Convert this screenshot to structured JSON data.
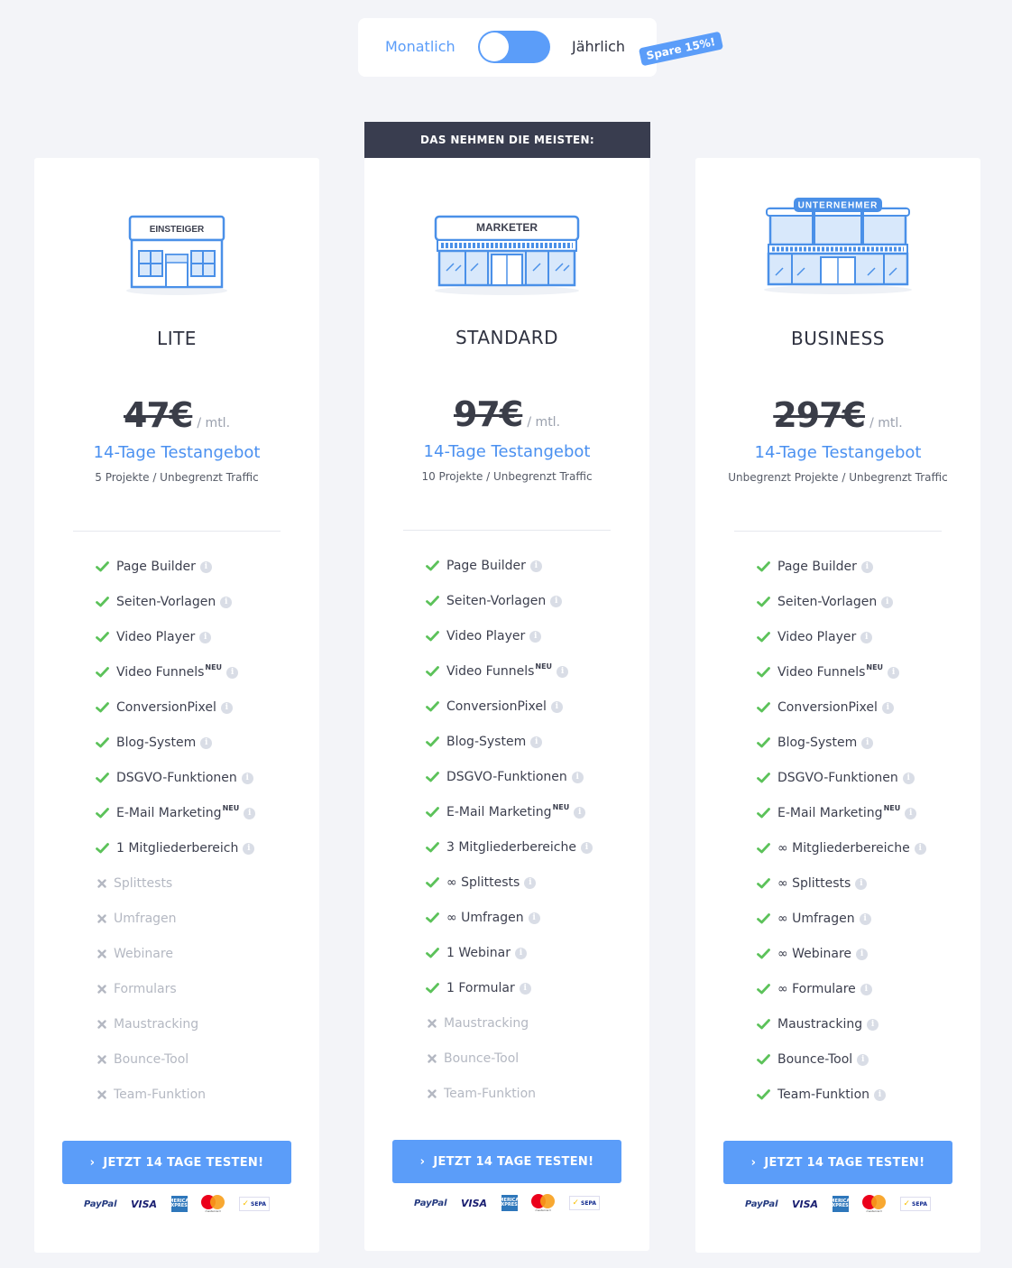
{
  "billing_toggle": {
    "monthly_label": "Monatlich",
    "yearly_label": "Jährlich",
    "save_badge": "Spare 15%!"
  },
  "popular_banner": "DAS NEHMEN DIE MEISTEN:",
  "colors": {
    "accent": "#5b9df9",
    "check": "#5cc25a",
    "banner": "#393d4f",
    "background": "#f3f4f8"
  },
  "plans": [
    {
      "shop_sign": "EINSTEIGER",
      "name": "LITE",
      "old_price": "47€",
      "price_unit": "/ mtl.",
      "trial": "14-Tage Testangebot",
      "limits": "5 Projekte / Unbegrenzt Traffic",
      "cta": "JETZT 14 TAGE TESTEN!",
      "payments": {
        "paypal": "PayPal",
        "visa": "VISA",
        "amex": "AMERICAN EXPRESS",
        "mastercard": "mastercard",
        "sepa": "SEPA"
      },
      "features": [
        {
          "text": "Page Builder",
          "included": true,
          "neu": false
        },
        {
          "text": "Seiten-Vorlagen",
          "included": true,
          "neu": false
        },
        {
          "text": "Video Player",
          "included": true,
          "neu": false
        },
        {
          "text": "Video Funnels",
          "included": true,
          "neu": true
        },
        {
          "text": "ConversionPixel",
          "included": true,
          "neu": false
        },
        {
          "text": "Blog-System",
          "included": true,
          "neu": false
        },
        {
          "text": "DSGVO-Funktionen",
          "included": true,
          "neu": false
        },
        {
          "text": "E-Mail Marketing",
          "included": true,
          "neu": true
        },
        {
          "text": "1 Mitgliederbereich",
          "included": true,
          "neu": false
        },
        {
          "text": "Splittests",
          "included": false,
          "neu": false
        },
        {
          "text": "Umfragen",
          "included": false,
          "neu": false
        },
        {
          "text": "Webinare",
          "included": false,
          "neu": false
        },
        {
          "text": "Formulars",
          "included": false,
          "neu": false
        },
        {
          "text": "Maustracking",
          "included": false,
          "neu": false
        },
        {
          "text": "Bounce-Tool",
          "included": false,
          "neu": false
        },
        {
          "text": "Team-Funktion",
          "included": false,
          "neu": false
        }
      ]
    },
    {
      "shop_sign": "MARKETER",
      "name": "STANDARD",
      "old_price": "97€",
      "price_unit": "/ mtl.",
      "trial": "14-Tage Testangebot",
      "limits": "10 Projekte / Unbegrenzt Traffic",
      "cta": "JETZT 14 TAGE TESTEN!",
      "payments": {
        "paypal": "PayPal",
        "visa": "VISA",
        "amex": "AMERICAN EXPRESS",
        "mastercard": "mastercard",
        "sepa": "SEPA"
      },
      "features": [
        {
          "text": "Page Builder",
          "included": true,
          "neu": false
        },
        {
          "text": "Seiten-Vorlagen",
          "included": true,
          "neu": false
        },
        {
          "text": "Video Player",
          "included": true,
          "neu": false
        },
        {
          "text": "Video Funnels",
          "included": true,
          "neu": true
        },
        {
          "text": "ConversionPixel",
          "included": true,
          "neu": false
        },
        {
          "text": "Blog-System",
          "included": true,
          "neu": false
        },
        {
          "text": "DSGVO-Funktionen",
          "included": true,
          "neu": false
        },
        {
          "text": "E-Mail Marketing",
          "included": true,
          "neu": true
        },
        {
          "text": "3 Mitgliederbereiche",
          "included": true,
          "neu": false
        },
        {
          "text": "∞ Splittests",
          "included": true,
          "neu": false
        },
        {
          "text": "∞ Umfragen",
          "included": true,
          "neu": false
        },
        {
          "text": "1 Webinar",
          "included": true,
          "neu": false
        },
        {
          "text": "1 Formular",
          "included": true,
          "neu": false
        },
        {
          "text": "Maustracking",
          "included": false,
          "neu": false
        },
        {
          "text": "Bounce-Tool",
          "included": false,
          "neu": false
        },
        {
          "text": "Team-Funktion",
          "included": false,
          "neu": false
        }
      ]
    },
    {
      "shop_sign": "UNTERNEHMER",
      "name": "BUSINESS",
      "old_price": "297€",
      "price_unit": "/ mtl.",
      "trial": "14-Tage Testangebot",
      "limits": "Unbegrenzt Projekte / Unbegrenzt Traffic",
      "cta": "JETZT 14 TAGE TESTEN!",
      "payments": {
        "paypal": "PayPal",
        "visa": "VISA",
        "amex": "AMERICAN EXPRESS",
        "mastercard": "mastercard",
        "sepa": "SEPA"
      },
      "features": [
        {
          "text": "Page Builder",
          "included": true,
          "neu": false
        },
        {
          "text": "Seiten-Vorlagen",
          "included": true,
          "neu": false
        },
        {
          "text": "Video Player",
          "included": true,
          "neu": false
        },
        {
          "text": "Video Funnels",
          "included": true,
          "neu": true
        },
        {
          "text": "ConversionPixel",
          "included": true,
          "neu": false
        },
        {
          "text": "Blog-System",
          "included": true,
          "neu": false
        },
        {
          "text": "DSGVO-Funktionen",
          "included": true,
          "neu": false
        },
        {
          "text": "E-Mail Marketing",
          "included": true,
          "neu": true
        },
        {
          "text": "∞ Mitgliederbereiche",
          "included": true,
          "neu": false
        },
        {
          "text": "∞ Splittests",
          "included": true,
          "neu": false
        },
        {
          "text": "∞ Umfragen",
          "included": true,
          "neu": false
        },
        {
          "text": "∞ Webinare",
          "included": true,
          "neu": false
        },
        {
          "text": "∞ Formulare",
          "included": true,
          "neu": false
        },
        {
          "text": "Maustracking",
          "included": true,
          "neu": false
        },
        {
          "text": "Bounce-Tool",
          "included": true,
          "neu": false
        },
        {
          "text": "Team-Funktion",
          "included": true,
          "neu": false
        }
      ]
    }
  ],
  "neu_label": "NEU",
  "info_glyph": "i"
}
